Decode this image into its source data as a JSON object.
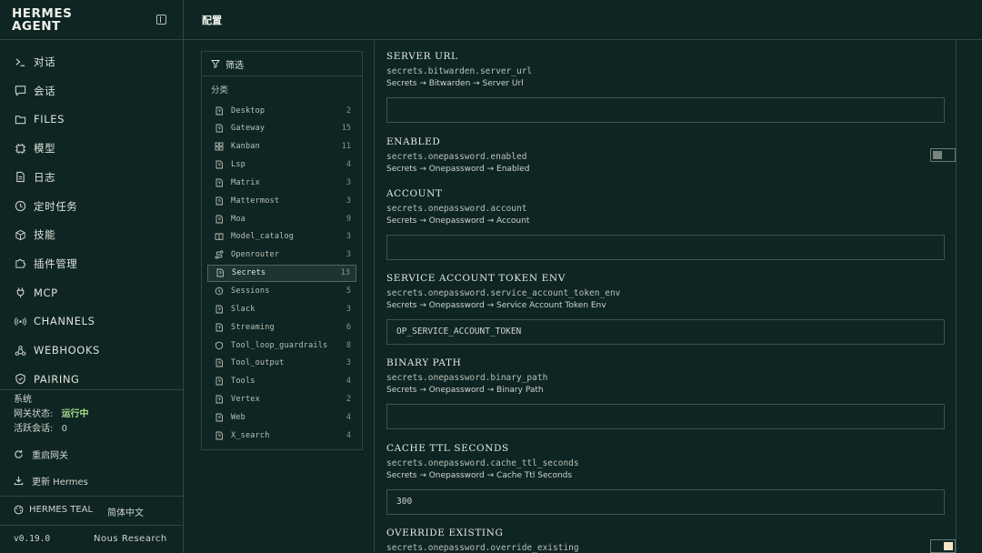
{
  "brand": {
    "line1": "HERMES",
    "line2": "AGENT"
  },
  "nav": [
    {
      "icon": "terminal-icon",
      "label": "对话"
    },
    {
      "icon": "chat-icon",
      "label": "会话"
    },
    {
      "icon": "folder-icon",
      "label": "FILES"
    },
    {
      "icon": "cpu-icon",
      "label": "模型"
    },
    {
      "icon": "document-icon",
      "label": "日志"
    },
    {
      "icon": "clock-icon",
      "label": "定时任务"
    },
    {
      "icon": "package-icon",
      "label": "技能"
    },
    {
      "icon": "puzzle-icon",
      "label": "插件管理"
    },
    {
      "icon": "plug-icon",
      "label": "MCP"
    },
    {
      "icon": "radio-icon",
      "label": "CHANNELS"
    },
    {
      "icon": "webhook-icon",
      "label": "WEBHOOKS"
    },
    {
      "icon": "shield-icon",
      "label": "PAIRING"
    }
  ],
  "system": {
    "title": "系统",
    "gateway_label": "网关状态:",
    "gateway_value": "运行中",
    "sessions_label": "活跃会话:",
    "sessions_value": "0",
    "restart_label": "重启网关",
    "update_label": "更新 Hermes"
  },
  "footer": {
    "theme": "HERMES TEAL",
    "language": "简体中文",
    "version": "v0.19.0",
    "vendor": "Nous Research"
  },
  "header": {
    "title": "配置"
  },
  "filter": {
    "label": "筛选",
    "category_label": "分类",
    "categories": [
      {
        "name": "Desktop",
        "count": "2",
        "icon": "file-icon"
      },
      {
        "name": "Gateway",
        "count": "15",
        "icon": "file-icon"
      },
      {
        "name": "Kanban",
        "count": "11",
        "icon": "grid-icon"
      },
      {
        "name": "Lsp",
        "count": "4",
        "icon": "file-icon"
      },
      {
        "name": "Matrix",
        "count": "3",
        "icon": "file-icon"
      },
      {
        "name": "Mattermost",
        "count": "3",
        "icon": "file-icon"
      },
      {
        "name": "Moa",
        "count": "9",
        "icon": "file-icon"
      },
      {
        "name": "Model_catalog",
        "count": "3",
        "icon": "book-icon"
      },
      {
        "name": "Openrouter",
        "count": "3",
        "icon": "route-icon"
      },
      {
        "name": "Secrets",
        "count": "13",
        "icon": "file-icon"
      },
      {
        "name": "Sessions",
        "count": "5",
        "icon": "history-icon"
      },
      {
        "name": "Slack",
        "count": "3",
        "icon": "file-icon"
      },
      {
        "name": "Streaming",
        "count": "6",
        "icon": "file-icon"
      },
      {
        "name": "Tool_loop_guardrails",
        "count": "8",
        "icon": "shield-icon"
      },
      {
        "name": "Tool_output",
        "count": "3",
        "icon": "file-icon"
      },
      {
        "name": "Tools",
        "count": "4",
        "icon": "file-icon"
      },
      {
        "name": "Vertex",
        "count": "2",
        "icon": "file-icon"
      },
      {
        "name": "Web",
        "count": "4",
        "icon": "file-icon"
      },
      {
        "name": "X_search",
        "count": "4",
        "icon": "file-icon"
      }
    ],
    "selected": "Secrets"
  },
  "fields": [
    {
      "title": "SERVER URL",
      "key": "secrets.bitwarden.server_url",
      "path": "Secrets → Bitwarden → Server Url",
      "type": "text",
      "value": ""
    },
    {
      "title": "ENABLED",
      "key": "secrets.onepassword.enabled",
      "path": "Secrets → Onepassword → Enabled",
      "type": "toggle",
      "on": false
    },
    {
      "title": "ACCOUNT",
      "key": "secrets.onepassword.account",
      "path": "Secrets → Onepassword → Account",
      "type": "text",
      "value": ""
    },
    {
      "title": "SERVICE ACCOUNT TOKEN ENV",
      "key": "secrets.onepassword.service_account_token_env",
      "path": "Secrets → Onepassword → Service Account Token Env",
      "type": "text",
      "value": "OP_SERVICE_ACCOUNT_TOKEN"
    },
    {
      "title": "BINARY PATH",
      "key": "secrets.onepassword.binary_path",
      "path": "Secrets → Onepassword → Binary Path",
      "type": "text",
      "value": ""
    },
    {
      "title": "CACHE TTL SECONDS",
      "key": "secrets.onepassword.cache_ttl_seconds",
      "path": "Secrets → Onepassword → Cache Ttl Seconds",
      "type": "text",
      "value": "300"
    },
    {
      "title": "OVERRIDE EXISTING",
      "key": "secrets.onepassword.override_existing",
      "path": "",
      "type": "toggle",
      "on": true
    }
  ]
}
